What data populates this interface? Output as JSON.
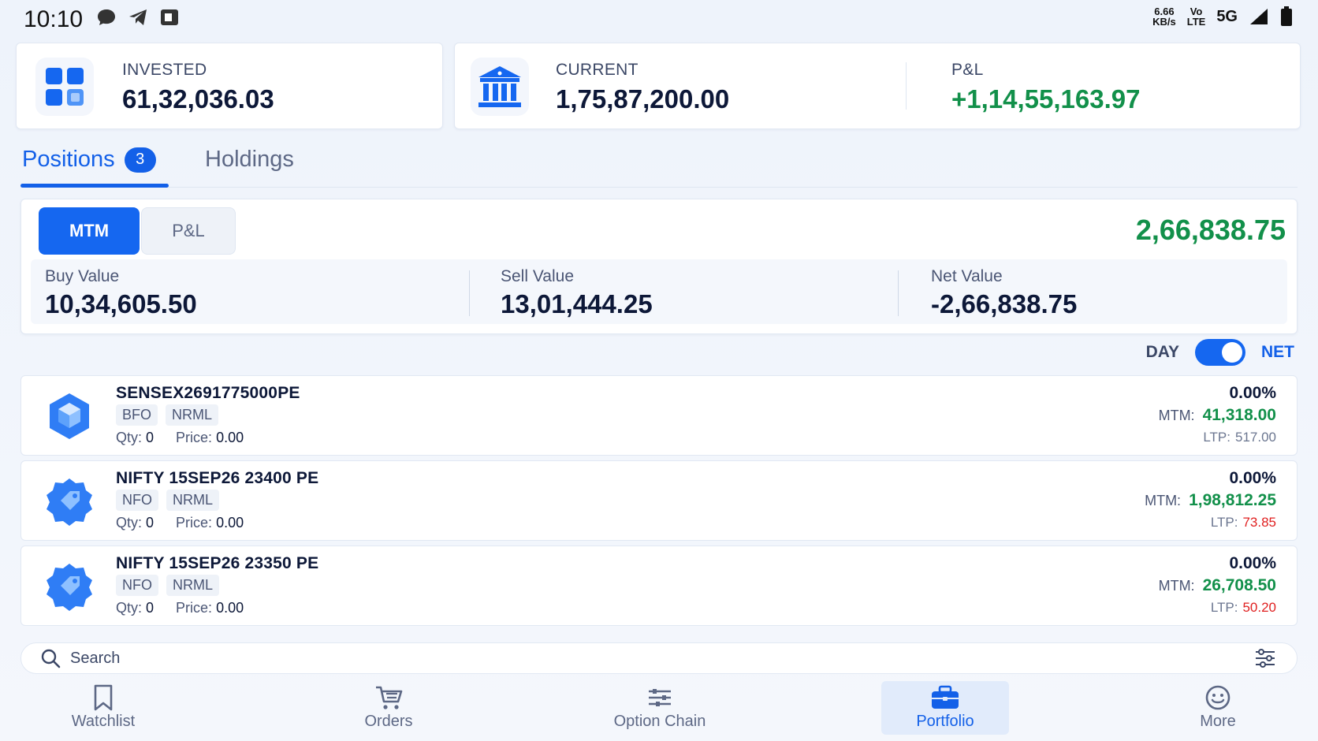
{
  "status_bar": {
    "time": "10:10",
    "speed_top": "6.66",
    "speed_bottom": "KB/s",
    "volte_top": "Vo",
    "volte_bottom": "LTE",
    "network": "5G",
    "icons": [
      "chat-bubble-icon",
      "telegram-icon",
      "app-icon",
      "signal-icon",
      "battery-icon"
    ]
  },
  "summary": {
    "invested": {
      "label": "INVESTED",
      "value": "61,32,036.03",
      "icon": "grid-icon"
    },
    "current": {
      "label": "CURRENT",
      "value": "1,75,87,200.00",
      "icon": "bank-icon"
    },
    "pnl": {
      "label": "P&L",
      "value": "+1,14,55,163.97"
    }
  },
  "tabs": {
    "positions": {
      "label": "Positions",
      "count": "3"
    },
    "holdings": {
      "label": "Holdings"
    }
  },
  "mtm_card": {
    "seg_mtm": "MTM",
    "seg_pnl": "P&L",
    "total": "2,66,838.75",
    "buy": {
      "label": "Buy Value",
      "value": "10,34,605.50"
    },
    "sell": {
      "label": "Sell Value",
      "value": "13,01,444.25"
    },
    "net": {
      "label": "Net Value",
      "value": "-2,66,838.75"
    }
  },
  "toggle": {
    "day": "DAY",
    "net": "NET",
    "net_on": true
  },
  "positions": [
    {
      "name": "SENSEX2691775000PE",
      "exchange": "BFO",
      "product": "NRML",
      "qty_label": "Qty:",
      "qty": "0",
      "price_label": "Price:",
      "price": "0.00",
      "pct": "0.00%",
      "mtm_label": "MTM:",
      "mtm": "41,318.00",
      "ltp_label": "LTP:",
      "ltp": "517.00",
      "icon": "cube-icon"
    },
    {
      "name": "NIFTY 15SEP26 23400 PE",
      "exchange": "NFO",
      "product": "NRML",
      "qty_label": "Qty:",
      "qty": "0",
      "price_label": "Price:",
      "price": "0.00",
      "pct": "0.00%",
      "mtm_label": "MTM:",
      "mtm": "1,98,812.25",
      "ltp_label": "LTP:",
      "ltp": "73.85",
      "icon": "tag-icon"
    },
    {
      "name": "NIFTY 15SEP26 23350 PE",
      "exchange": "NFO",
      "product": "NRML",
      "qty_label": "Qty:",
      "qty": "0",
      "price_label": "Price:",
      "price": "0.00",
      "pct": "0.00%",
      "mtm_label": "MTM:",
      "mtm": "26,708.50",
      "ltp_label": "LTP:",
      "ltp": "50.20",
      "icon": "tag-icon"
    }
  ],
  "search": {
    "placeholder": "Search"
  },
  "nav": {
    "watchlist": "Watchlist",
    "orders": "Orders",
    "option_chain": "Option Chain",
    "portfolio": "Portfolio",
    "more": "More",
    "active": "portfolio"
  },
  "colors": {
    "accent": "#1360e8",
    "positive": "#12904a",
    "negative": "#e02020"
  }
}
